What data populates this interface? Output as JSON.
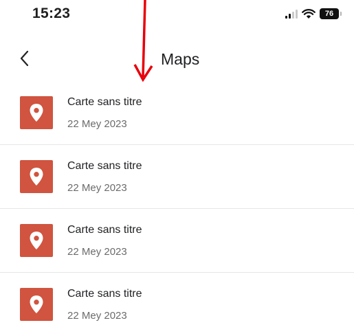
{
  "status_bar": {
    "time": "15:23",
    "battery": "76",
    "icons": [
      "signal-icon",
      "wifi-icon",
      "battery-icon"
    ]
  },
  "nav": {
    "title": "Maps",
    "back_icon": "chevron-left-icon"
  },
  "annotation": {
    "icon": "arrow-down-icon",
    "color": "#e8000b"
  },
  "accent_color": "#d0543f",
  "maps": [
    {
      "title": "Carte sans titre",
      "date": "22 Mey 2023",
      "icon": "map-pin-icon"
    },
    {
      "title": "Carte sans titre",
      "date": "22 Mey 2023",
      "icon": "map-pin-icon"
    },
    {
      "title": "Carte sans titre",
      "date": "22 Mey 2023",
      "icon": "map-pin-icon"
    },
    {
      "title": "Carte sans titre",
      "date": "22 Mey 2023",
      "icon": "map-pin-icon"
    }
  ]
}
